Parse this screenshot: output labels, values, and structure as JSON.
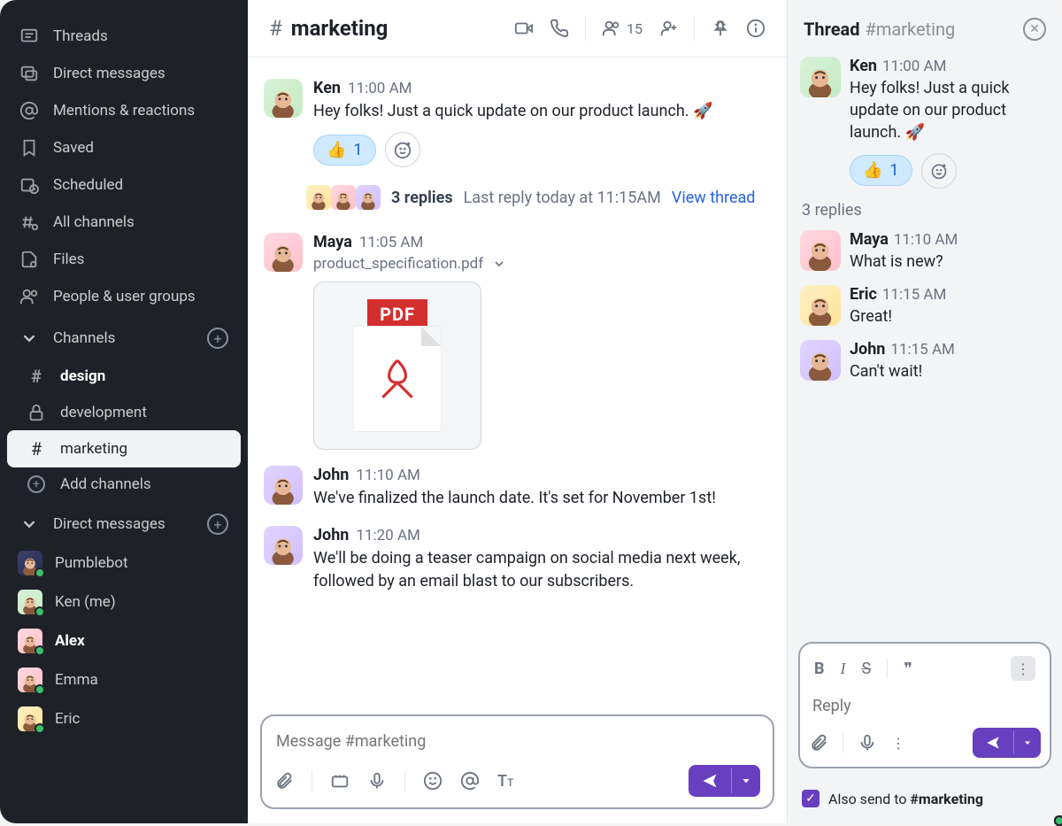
{
  "sidebar": {
    "nav": [
      {
        "label": "Threads",
        "icon": "threads"
      },
      {
        "label": "Direct messages",
        "icon": "dm"
      },
      {
        "label": "Mentions & reactions",
        "icon": "mentions"
      },
      {
        "label": "Saved",
        "icon": "saved"
      },
      {
        "label": "Scheduled",
        "icon": "scheduled"
      },
      {
        "label": "All channels",
        "icon": "allchannels"
      },
      {
        "label": "Files",
        "icon": "files"
      },
      {
        "label": "People & user groups",
        "icon": "people"
      }
    ],
    "channels_label": "Channels",
    "channels": [
      {
        "name": "design",
        "icon": "hash",
        "bold": true
      },
      {
        "name": "development",
        "icon": "lock"
      },
      {
        "name": "marketing",
        "icon": "hash",
        "active": true
      }
    ],
    "add_channels_label": "Add channels",
    "dm_label": "Direct messages",
    "dms": [
      {
        "name": "Pumblebot",
        "avatar": "bot"
      },
      {
        "name": "Ken (me)",
        "avatar": "ken"
      },
      {
        "name": "Alex",
        "avatar": "maya",
        "bold": true
      },
      {
        "name": "Emma",
        "avatar": "maya2"
      },
      {
        "name": "Eric",
        "avatar": "eric"
      }
    ]
  },
  "channel": {
    "hash": "#",
    "name": "marketing",
    "member_count": "15"
  },
  "messages": [
    {
      "author": "Ken",
      "avatar": "ken",
      "time": "11:00 AM",
      "text": "Hey folks! Just a quick update on our product launch. 🚀",
      "reactions": [
        {
          "emoji": "👍",
          "count": "1"
        }
      ],
      "thread": {
        "replies": "3 replies",
        "last": "Last reply today at 11:15AM",
        "view": "View thread"
      }
    },
    {
      "author": "Maya",
      "avatar": "maya",
      "time": "11:05 AM",
      "file": "product_specification.pdf"
    },
    {
      "author": "John",
      "avatar": "john",
      "time": "11:10 AM",
      "text": "We've finalized the launch date. It's set for November 1st!"
    },
    {
      "author": "John",
      "avatar": "john",
      "time": "11:20 AM",
      "text": "We'll be doing a teaser campaign on social media next week, followed by an email blast to our subscribers."
    }
  ],
  "composer": {
    "placeholder": "Message #marketing"
  },
  "thread": {
    "title": "Thread",
    "subtitle": "#marketing",
    "root": {
      "author": "Ken",
      "avatar": "ken",
      "time": "11:00 AM",
      "text": "Hey folks! Just a quick update on our product launch. 🚀",
      "reactions": [
        {
          "emoji": "👍",
          "count": "1"
        }
      ]
    },
    "count_label": "3 replies",
    "replies": [
      {
        "author": "Maya",
        "avatar": "maya",
        "time": "11:10 AM",
        "text": "What is new?"
      },
      {
        "author": "Eric",
        "avatar": "eric",
        "time": "11:15 AM",
        "text": "Great!"
      },
      {
        "author": "John",
        "avatar": "john",
        "time": "11:15 AM",
        "text": "Can't wait!"
      }
    ],
    "composer": {
      "placeholder": "Reply"
    },
    "also_send_prefix": "Also send to ",
    "also_send_channel": "#marketing"
  },
  "pdf_label": "PDF"
}
